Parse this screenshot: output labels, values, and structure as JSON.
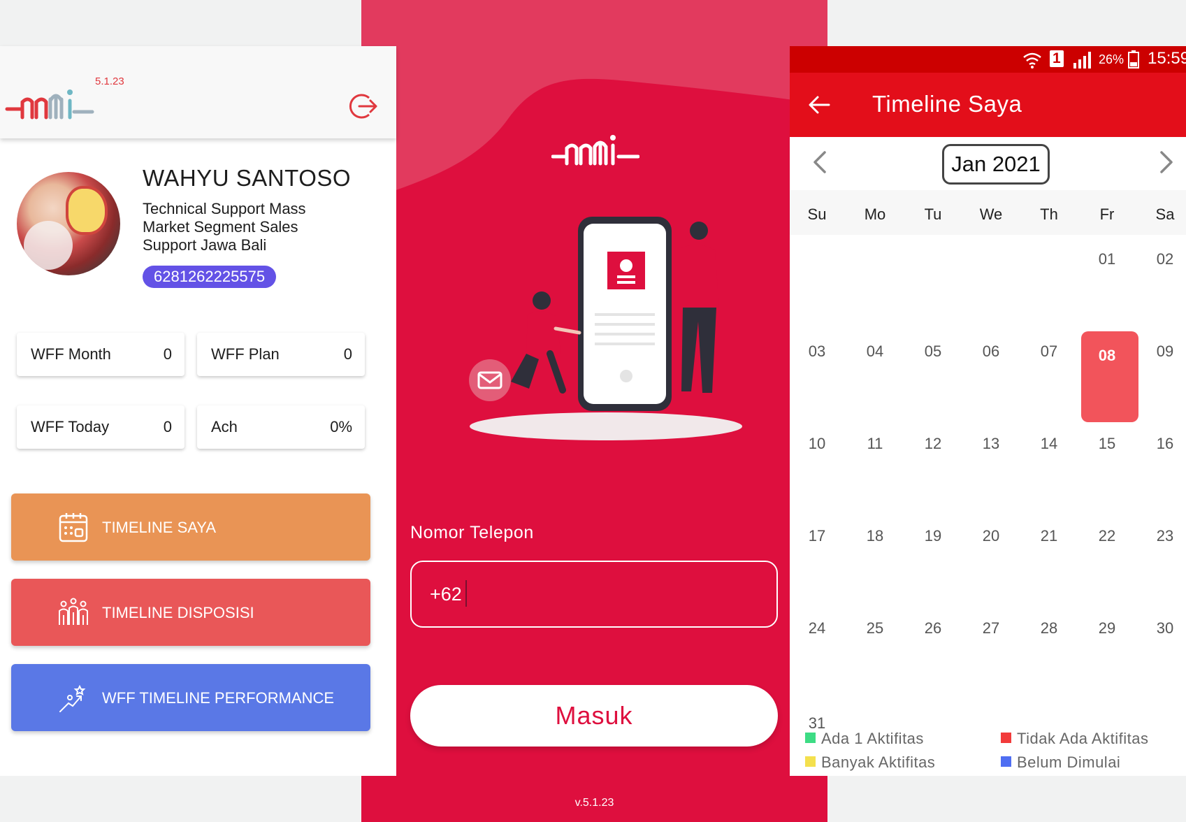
{
  "home": {
    "version": "5.1.23",
    "user_name": "WAHYU SANTOSO",
    "role": "Technical Support Mass Market Segment Sales Support Jawa Bali",
    "phone": "6281262225575",
    "stats": [
      {
        "label": "WFF Month",
        "value": "0"
      },
      {
        "label": "WFF Plan",
        "value": "0"
      },
      {
        "label": "WFF Today",
        "value": "0"
      },
      {
        "label": "Ach",
        "value": "0%"
      }
    ],
    "menu": [
      {
        "label": "TIMELINE SAYA",
        "color": "#e99455",
        "icon": "calendar-icon"
      },
      {
        "label": "TIMELINE DISPOSISI",
        "color": "#e95758",
        "icon": "team-icon"
      },
      {
        "label": "WFF TIMELINE PERFORMANCE",
        "color": "#5a78e6",
        "icon": "performance-icon"
      }
    ]
  },
  "login": {
    "phone_label": "Nomor Telepon",
    "phone_value": "+62",
    "login_label": "Masuk",
    "version": "v.5.1.23",
    "brand_color": "#de0f3e"
  },
  "timeline": {
    "status": {
      "battery": "26%",
      "time": "15:59",
      "sim": "1"
    },
    "title": "Timeline Saya",
    "month": "Jan 2021",
    "weekdays": [
      "Su",
      "Mo",
      "Tu",
      "We",
      "Th",
      "Fr",
      "Sa"
    ],
    "weeks": [
      [
        "",
        "",
        "",
        "",
        "",
        "01",
        "02"
      ],
      [
        "03",
        "04",
        "05",
        "06",
        "07",
        "08",
        "09"
      ],
      [
        "10",
        "11",
        "12",
        "13",
        "14",
        "15",
        "16"
      ],
      [
        "17",
        "18",
        "19",
        "20",
        "21",
        "22",
        "23"
      ],
      [
        "24",
        "25",
        "26",
        "27",
        "28",
        "29",
        "30"
      ],
      [
        "31",
        "",
        "",
        "",
        "",
        "",
        ""
      ]
    ],
    "selected_day": "08",
    "legend": [
      {
        "label": "Ada 1 Aktifitas",
        "color": "#3ddc84"
      },
      {
        "label": "Tidak Ada Aktifitas",
        "color": "#f23b3b"
      },
      {
        "label": "Banyak Aktifitas",
        "color": "#f4e04d"
      },
      {
        "label": "Belum Dimulai",
        "color": "#4f6ef2"
      }
    ],
    "accent": "#e30e1a"
  }
}
